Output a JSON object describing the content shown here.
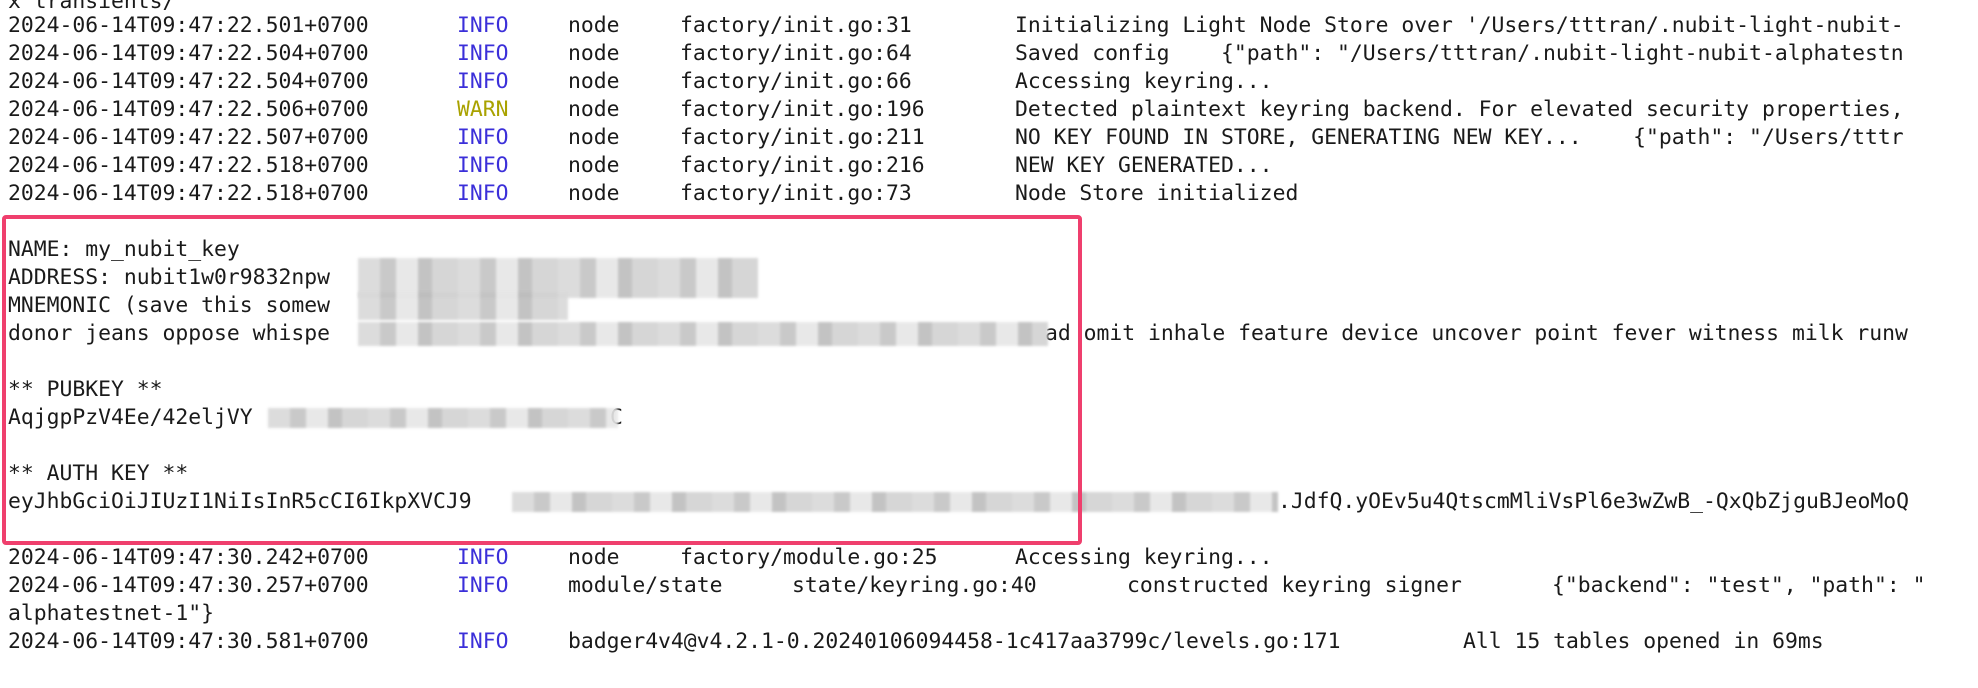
{
  "top_partial": "x transients/",
  "log_lines": [
    {
      "ts": "2024-06-14T09:47:22.501+0700",
      "level": "INFO",
      "module": "node",
      "source": "factory/init.go:31",
      "message": "Initializing Light Node Store over '/Users/tttran/.nubit-light-nubit-"
    },
    {
      "ts": "2024-06-14T09:47:22.504+0700",
      "level": "INFO",
      "module": "node",
      "source": "factory/init.go:64",
      "message": "Saved config    {\"path\": \"/Users/tttran/.nubit-light-nubit-alphatestn"
    },
    {
      "ts": "2024-06-14T09:47:22.504+0700",
      "level": "INFO",
      "module": "node",
      "source": "factory/init.go:66",
      "message": "Accessing keyring..."
    },
    {
      "ts": "2024-06-14T09:47:22.506+0700",
      "level": "WARN",
      "module": "node",
      "source": "factory/init.go:196",
      "message": "Detected plaintext keyring backend. For elevated security properties,"
    },
    {
      "ts": "2024-06-14T09:47:22.507+0700",
      "level": "INFO",
      "module": "node",
      "source": "factory/init.go:211",
      "message": "NO KEY FOUND IN STORE, GENERATING NEW KEY...    {\"path\": \"/Users/tttr"
    },
    {
      "ts": "2024-06-14T09:47:22.518+0700",
      "level": "INFO",
      "module": "node",
      "source": "factory/init.go:216",
      "message": "NEW KEY GENERATED..."
    },
    {
      "ts": "2024-06-14T09:47:22.518+0700",
      "level": "INFO",
      "module": "node",
      "source": "factory/init.go:73",
      "message": "Node Store initialized"
    }
  ],
  "key_block": {
    "name_line": "NAME: my_nubit_key",
    "address_prefix": "ADDRESS: nubit1w0r9832npw",
    "mnemonic_label_prefix": "MNEMONIC (save this somew",
    "mnemonic_prefix": "donor jeans oppose whispe",
    "mnemonic_suffix": "ad omit inhale feature device uncover point fever witness milk runw",
    "pubkey_header": "** PUBKEY **",
    "pubkey_prefix": "AqjgpPzV4Ee/42eljVY",
    "pubkey_tail": "C",
    "auth_header": "** AUTH KEY **",
    "auth_prefix": "eyJhbGciOiJIUzI1NiIsInR5cCI6IkpXVCJ9",
    "auth_suffix": ".JdfQ.yOEv5u4QtscmMliVsPl6e3wZwB_-QxQbZjguBJeoMoQ"
  },
  "log_lines_after": [
    {
      "ts": "2024-06-14T09:47:30.242+0700",
      "level": "INFO",
      "module": "node",
      "source": "factory/module.go:25",
      "message": "Accessing keyring..."
    }
  ],
  "keyring_line": {
    "ts": "2024-06-14T09:47:30.257+0700",
    "level": "INFO",
    "module": "module/state",
    "source": "state/keyring.go:40",
    "message": "constructed keyring signer       {\"backend\": \"test\", \"path\": \""
  },
  "wrap_line": "alphatestnet-1\"}",
  "badger_line": {
    "ts": "2024-06-14T09:47:30.581+0700",
    "level": "INFO",
    "module": "badger4",
    "source": "v4@v4.2.1-0.20240106094458-1c417aa3799c/levels.go:171",
    "message": "All 15 tables opened in 69ms"
  },
  "colors": {
    "info": "#3b2fd9",
    "warn": "#a9a200",
    "highlight": "#ef3f6d"
  }
}
